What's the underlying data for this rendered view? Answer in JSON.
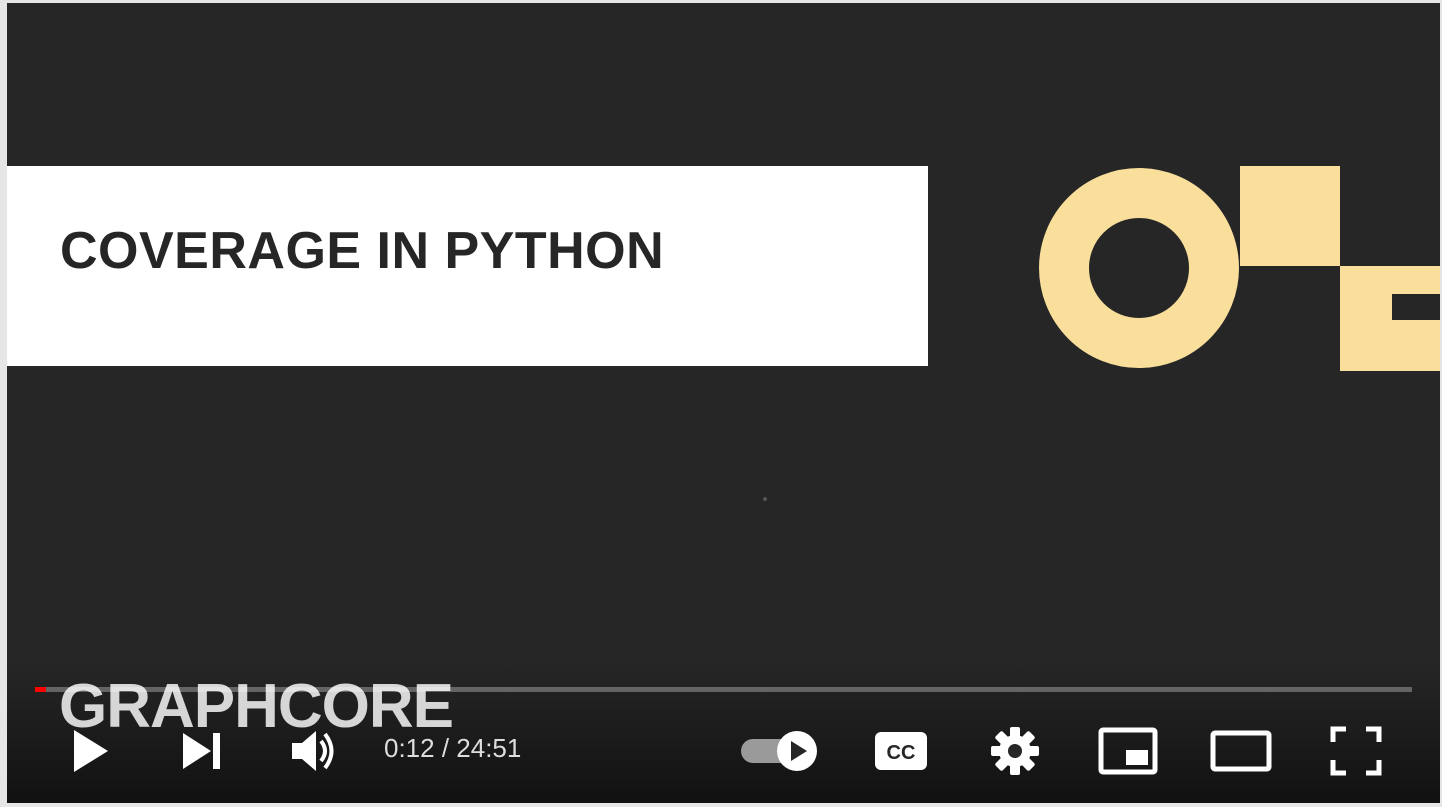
{
  "video": {
    "title_card": "COVERAGE IN PYTHON",
    "watermark": "GRAPHCORE"
  },
  "colors": {
    "background": "#262626",
    "brand_accent": "#f9df9b",
    "progress": "#ff0000"
  },
  "player": {
    "current_time": "0:12",
    "duration": "24:51",
    "time_display": "0:12 / 24:51",
    "progress_fraction": 0.008
  },
  "controls": {
    "icons": [
      "play-icon",
      "next-icon",
      "volume-icon",
      "autoplay-toggle",
      "captions-icon",
      "settings-icon",
      "miniplayer-icon",
      "theater-mode-icon",
      "fullscreen-icon"
    ],
    "captions_label": "CC"
  }
}
